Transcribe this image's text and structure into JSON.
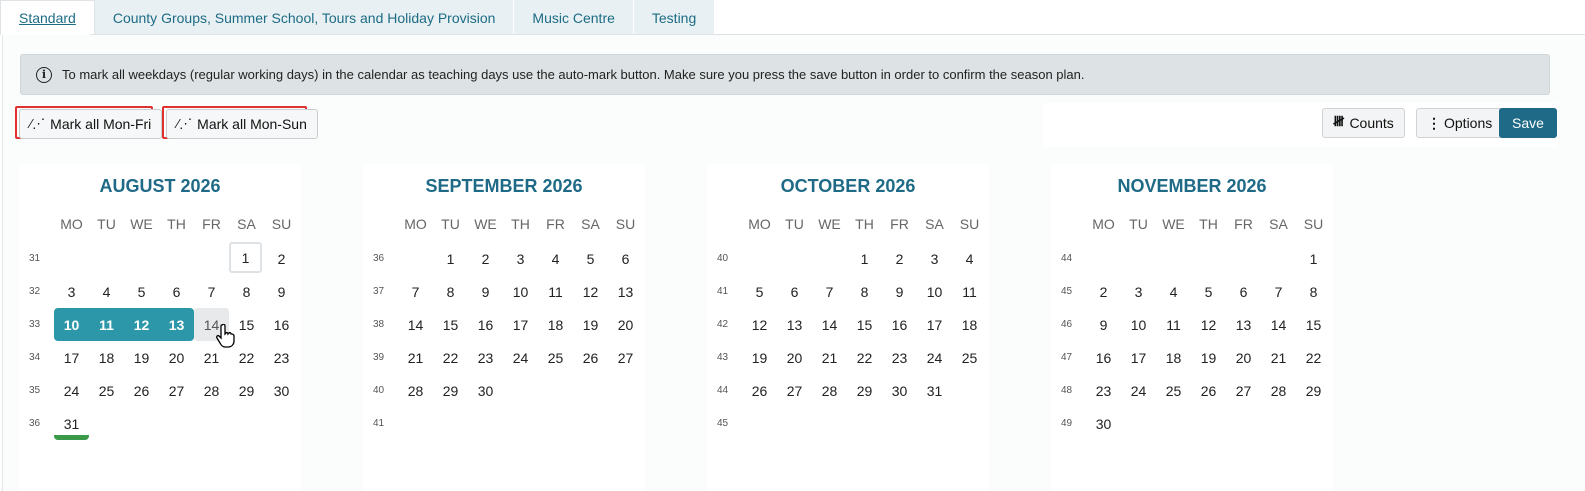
{
  "tabs": [
    {
      "label": "Standard",
      "active": true
    },
    {
      "label": "County Groups, Summer School, Tours and Holiday Provision",
      "active": false
    },
    {
      "label": "Music Centre",
      "active": false
    },
    {
      "label": "Testing",
      "active": false
    }
  ],
  "info": {
    "icon": "info-icon",
    "text": "To mark all weekdays (regular working days) in the calendar as teaching days use the auto-mark button. Make sure you press the save button in order to confirm the season plan."
  },
  "toolbar": {
    "mark_mon_fri": "Mark all Mon-Fri",
    "mark_mon_sun": "Mark all Mon-Sun",
    "counts": "Counts",
    "options": "Options",
    "save": "Save",
    "accent_color": "#1f6a86",
    "highlight_color": "#e03131"
  },
  "weekdays": [
    "MO",
    "TU",
    "WE",
    "TH",
    "FR",
    "SA",
    "SU"
  ],
  "months": [
    {
      "title": "AUGUST 2026",
      "weeks": [
        {
          "wk": "31",
          "days": [
            "",
            "",
            "",
            "",
            "",
            "1",
            "2"
          ]
        },
        {
          "wk": "32",
          "days": [
            "3",
            "4",
            "5",
            "6",
            "7",
            "8",
            "9"
          ]
        },
        {
          "wk": "33",
          "days": [
            "10",
            "11",
            "12",
            "13",
            "14",
            "15",
            "16"
          ]
        },
        {
          "wk": "34",
          "days": [
            "17",
            "18",
            "19",
            "20",
            "21",
            "22",
            "23"
          ]
        },
        {
          "wk": "35",
          "days": [
            "24",
            "25",
            "26",
            "27",
            "28",
            "29",
            "30"
          ]
        },
        {
          "wk": "36",
          "days": [
            "31",
            "",
            "",
            "",
            "",
            "",
            ""
          ]
        }
      ],
      "selected": [
        "10",
        "11",
        "12",
        "13"
      ],
      "hovered": "14",
      "outlined": "1",
      "underlined": "31"
    },
    {
      "title": "SEPTEMBER 2026",
      "weeks": [
        {
          "wk": "36",
          "days": [
            "",
            "1",
            "2",
            "3",
            "4",
            "5",
            "6"
          ]
        },
        {
          "wk": "37",
          "days": [
            "7",
            "8",
            "9",
            "10",
            "11",
            "12",
            "13"
          ]
        },
        {
          "wk": "38",
          "days": [
            "14",
            "15",
            "16",
            "17",
            "18",
            "19",
            "20"
          ]
        },
        {
          "wk": "39",
          "days": [
            "21",
            "22",
            "23",
            "24",
            "25",
            "26",
            "27"
          ]
        },
        {
          "wk": "40",
          "days": [
            "28",
            "29",
            "30",
            "",
            "",
            "",
            ""
          ]
        },
        {
          "wk": "41",
          "days": [
            "",
            "",
            "",
            "",
            "",
            "",
            ""
          ]
        }
      ],
      "selected": [],
      "hovered": "",
      "outlined": "",
      "underlined": ""
    },
    {
      "title": "OCTOBER 2026",
      "weeks": [
        {
          "wk": "40",
          "days": [
            "",
            "",
            "",
            "1",
            "2",
            "3",
            "4"
          ]
        },
        {
          "wk": "41",
          "days": [
            "5",
            "6",
            "7",
            "8",
            "9",
            "10",
            "11"
          ]
        },
        {
          "wk": "42",
          "days": [
            "12",
            "13",
            "14",
            "15",
            "16",
            "17",
            "18"
          ]
        },
        {
          "wk": "43",
          "days": [
            "19",
            "20",
            "21",
            "22",
            "23",
            "24",
            "25"
          ]
        },
        {
          "wk": "44",
          "days": [
            "26",
            "27",
            "28",
            "29",
            "30",
            "31",
            ""
          ]
        },
        {
          "wk": "45",
          "days": [
            "",
            "",
            "",
            "",
            "",
            "",
            ""
          ]
        }
      ],
      "selected": [],
      "hovered": "",
      "outlined": "",
      "underlined": ""
    },
    {
      "title": "NOVEMBER 2026",
      "weeks": [
        {
          "wk": "44",
          "days": [
            "",
            "",
            "",
            "",
            "",
            "",
            "1"
          ]
        },
        {
          "wk": "45",
          "days": [
            "2",
            "3",
            "4",
            "5",
            "6",
            "7",
            "8"
          ]
        },
        {
          "wk": "46",
          "days": [
            "9",
            "10",
            "11",
            "12",
            "13",
            "14",
            "15"
          ]
        },
        {
          "wk": "47",
          "days": [
            "16",
            "17",
            "18",
            "19",
            "20",
            "21",
            "22"
          ]
        },
        {
          "wk": "48",
          "days": [
            "23",
            "24",
            "25",
            "26",
            "27",
            "28",
            "29"
          ]
        },
        {
          "wk": "49",
          "days": [
            "30",
            "",
            "",
            "",
            "",
            "",
            ""
          ]
        }
      ],
      "selected": [],
      "hovered": "",
      "outlined": "",
      "underlined": ""
    }
  ]
}
